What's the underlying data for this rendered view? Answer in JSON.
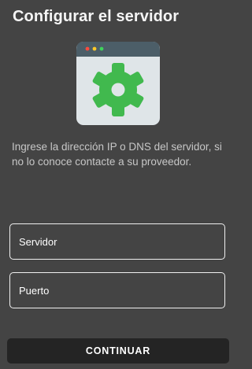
{
  "screen": {
    "title": "Configurar el servidor",
    "description": "Ingrese la dirección IP o DNS del servidor, si no lo conoce contacte a su proveedor."
  },
  "illustration": {
    "icon": "settings-gear-icon",
    "window_dots": [
      "#ff4b3e",
      "#ffc928",
      "#3fd35b"
    ],
    "colors": {
      "window_bar": "#4c5e68",
      "window_body": "#dfe5e8",
      "gear": "#41b94e"
    }
  },
  "form": {
    "server_placeholder": "Servidor",
    "port_placeholder": "Puerto",
    "continue_label": "CONTINUAR"
  },
  "theme": {
    "background": "#444444",
    "button_background": "#242424",
    "text": "#f5f5f5"
  }
}
